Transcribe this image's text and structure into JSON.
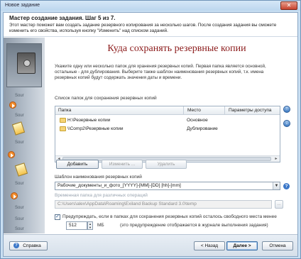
{
  "window": {
    "title": "Новое задание",
    "close_glyph": "✕"
  },
  "header": {
    "title": "Мастер создание задания.  Шаг 5 из 7.",
    "description": "Этот мастер поможет вам создать задание резервного копирования за несколько шагов. После создания задания вы сможете изменить его свойства, используя кнопку \"Изменить\" над списком заданий."
  },
  "sidebar": {
    "faint_labels": [
      "Sour",
      "Sour",
      "Sour",
      "Sour",
      "Sour",
      "Sour",
      "Sour"
    ]
  },
  "main": {
    "page_title": "Куда сохранять резервные копии",
    "intro": "Укажите одну или несколько папок для хранения резервных копий. Первая папка является основной, остальные - для дублирования. Выберите также шаблон наименования резервных копий, т.к. имена резервных копий будут содержать значения даты и времени.",
    "list_label": "Список папок для сохранения резервных копий",
    "columns": [
      "Папка",
      "Место",
      "Параметры доступа"
    ],
    "rows": [
      {
        "folder": "H:\\Резервные копии",
        "place": "Основное"
      },
      {
        "folder": "\\\\Comp2\\Резервные копии",
        "place": "Дублирование"
      }
    ],
    "buttons": {
      "add": "Добавить",
      "edit": "Изменить ...",
      "delete": "Удалить",
      "browse": "..."
    },
    "template_label": "Шаблон наименования резервных копий",
    "template_value": "Рабочие_документы_и_фото_[YYYY]-[MM]-[DD] [hh]-[mm]",
    "temp_label": "Временная папка для различных операций",
    "temp_value": "C:\\Users\\alex\\AppData\\Roaming\\Exiland Backup Standard 3.0\\temp",
    "warn_label": "Предупреждать, если в папках для сохранения резервных копий осталось свободного места менее",
    "warn_checked": "✓",
    "warn_value": "512",
    "warn_unit": "МБ",
    "warn_note": "(это предупреждение отображается в журнале выполнения задания)",
    "help_glyph": "?",
    "combo_glyph": "▼",
    "up_glyph": "↑",
    "down_glyph": "↓"
  },
  "footer": {
    "help": "Справка",
    "back": "< Назад",
    "next": "Далее >",
    "cancel": "Отмена"
  }
}
